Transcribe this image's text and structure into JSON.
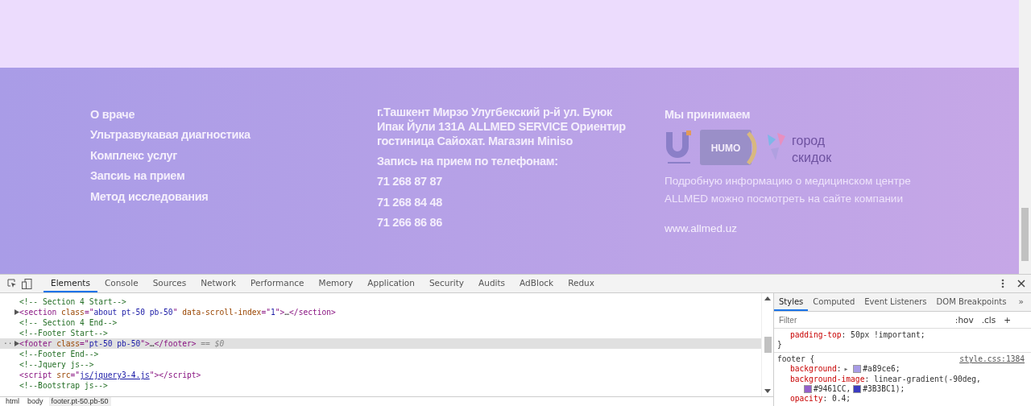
{
  "footer": {
    "links": [
      "О враче",
      "Ультразвукавая диагностика",
      "Комплекс услуг",
      "Запсиь на прием",
      "Метод исследования"
    ],
    "address": "г.Ташкент Мирзо Улугбекский р-й ул. Буюк Ипак Йули 131А ALLMED SERVICE Ориентир гостиница Сайохат. Магазин Miniso",
    "phones_label": "Запись на прием по телефонам:",
    "phones": [
      "71 268 87 87",
      "71 268 84 48",
      "71 266 86 86"
    ],
    "accept_title": "Мы принимаем",
    "cards": [
      {
        "kind": "uzcard"
      },
      {
        "kind": "humo",
        "label": "HUMO"
      },
      {
        "kind": "city",
        "lines": [
          "город",
          "скидок"
        ]
      }
    ],
    "info": "Подробную информацию о медицинском центре ALLMED можно посмотреть на сайте компании",
    "site": "www.allmed.uz"
  },
  "devtools": {
    "tabs": [
      {
        "label": "Elements",
        "selected": true
      },
      {
        "label": "Console",
        "selected": false
      },
      {
        "label": "Sources",
        "selected": false
      },
      {
        "label": "Network",
        "selected": false
      },
      {
        "label": "Performance",
        "selected": false
      },
      {
        "label": "Memory",
        "selected": false
      },
      {
        "label": "Application",
        "selected": false
      },
      {
        "label": "Security",
        "selected": false
      },
      {
        "label": "Audits",
        "selected": false
      },
      {
        "label": "AdBlock",
        "selected": false
      },
      {
        "label": "Redux",
        "selected": false
      }
    ],
    "lines": [
      {
        "expandable": false,
        "selected": false,
        "tokens": [
          {
            "kind": "comment",
            "text": "<!-- Section 4 Start-->"
          }
        ]
      },
      {
        "expandable": true,
        "selected": false,
        "tokens": [
          {
            "kind": "tag",
            "text": "<section"
          },
          {
            "kind": "attr",
            "text": " class"
          },
          {
            "kind": "tag",
            "text": "=\""
          },
          {
            "kind": "value",
            "text": "about pt-50 pb-50"
          },
          {
            "kind": "tag",
            "text": "\""
          },
          {
            "kind": "attr",
            "text": " data-scroll-index"
          },
          {
            "kind": "tag",
            "text": "=\""
          },
          {
            "kind": "value",
            "text": "1"
          },
          {
            "kind": "tag",
            "text": "\">"
          },
          {
            "kind": "plain",
            "text": "…"
          },
          {
            "kind": "tag",
            "text": "</section>"
          }
        ]
      },
      {
        "expandable": false,
        "selected": false,
        "tokens": [
          {
            "kind": "comment",
            "text": "<!-- Section 4 End-->"
          }
        ]
      },
      {
        "expandable": false,
        "selected": false,
        "tokens": [
          {
            "kind": "comment",
            "text": "<!--Footer Start-->"
          }
        ]
      },
      {
        "expandable": true,
        "selected": true,
        "gutter": "···",
        "tokens": [
          {
            "kind": "tag",
            "text": "<footer"
          },
          {
            "kind": "attr",
            "text": " class"
          },
          {
            "kind": "tag",
            "text": "=\""
          },
          {
            "kind": "value",
            "text": "pt-50 pb-50"
          },
          {
            "kind": "tag",
            "text": "\">"
          },
          {
            "kind": "plain",
            "text": "…"
          },
          {
            "kind": "tag",
            "text": "</footer>"
          },
          {
            "kind": "ref",
            "text": " == $0"
          }
        ]
      },
      {
        "expandable": false,
        "selected": false,
        "tokens": [
          {
            "kind": "comment",
            "text": "<!--Footer End-->"
          }
        ]
      },
      {
        "expandable": false,
        "selected": false,
        "tokens": [
          {
            "kind": "comment",
            "text": "<!--Jquery js-->"
          }
        ]
      },
      {
        "expandable": false,
        "selected": false,
        "tokens": [
          {
            "kind": "tag",
            "text": "<script"
          },
          {
            "kind": "attr",
            "text": " src"
          },
          {
            "kind": "tag",
            "text": "=\""
          },
          {
            "kind": "link",
            "text": "js/jquery3-4.js"
          },
          {
            "kind": "tag",
            "text": "\"></script>"
          }
        ]
      },
      {
        "expandable": false,
        "selected": false,
        "tokens": [
          {
            "kind": "comment",
            "text": "<!--Bootstrap js-->"
          }
        ]
      }
    ],
    "breadcrumbs": [
      {
        "label": "html",
        "selected": false
      },
      {
        "label": "body",
        "selected": false
      },
      {
        "label": "footer.pt-50.pb-50",
        "selected": true
      }
    ],
    "side_tabs": [
      {
        "label": "Styles",
        "selected": true
      },
      {
        "label": "Computed",
        "selected": false
      },
      {
        "label": "Event Listeners",
        "selected": false
      },
      {
        "label": "DOM Breakpoints",
        "selected": false
      }
    ],
    "more": "»",
    "filter": {
      "placeholder": "Filter"
    },
    "hov": ":hov",
    "cls": ".cls",
    "add": "+",
    "prev_rule": {
      "prop": "padding-top",
      "sep": ":",
      "value": " 50px !important;",
      "close": "}"
    },
    "rule": {
      "selector": "footer {",
      "source": "style.css:1384",
      "props": [
        {
          "kind": "declaration",
          "tokens": [
            {
              "kind": "name",
              "text": "background"
            },
            {
              "kind": "text",
              "text": ":"
            },
            {
              "kind": "arrow",
              "text": "▸"
            },
            {
              "kind": "color",
              "text": "#a89ce6"
            },
            {
              "kind": "text",
              "text": ";"
            }
          ]
        },
        {
          "kind": "declaration",
          "tokens": [
            {
              "kind": "name",
              "text": "background-image"
            },
            {
              "kind": "text",
              "text": ":"
            },
            {
              "kind": "text",
              "text": " linear-gradient(-90deg,"
            }
          ]
        },
        {
          "kind": "continuation",
          "tokens": [
            {
              "kind": "color",
              "text": "#9461CC"
            },
            {
              "kind": "text",
              "text": ","
            },
            {
              "kind": "color",
              "text": "#3B3BC1"
            },
            {
              "kind": "text",
              "text": ");"
            }
          ]
        },
        {
          "kind": "declaration",
          "tokens": [
            {
              "kind": "name",
              "text": "opacity"
            },
            {
              "kind": "text",
              "text": ":"
            },
            {
              "kind": "text",
              "text": " 0.4;"
            }
          ]
        }
      ]
    }
  }
}
